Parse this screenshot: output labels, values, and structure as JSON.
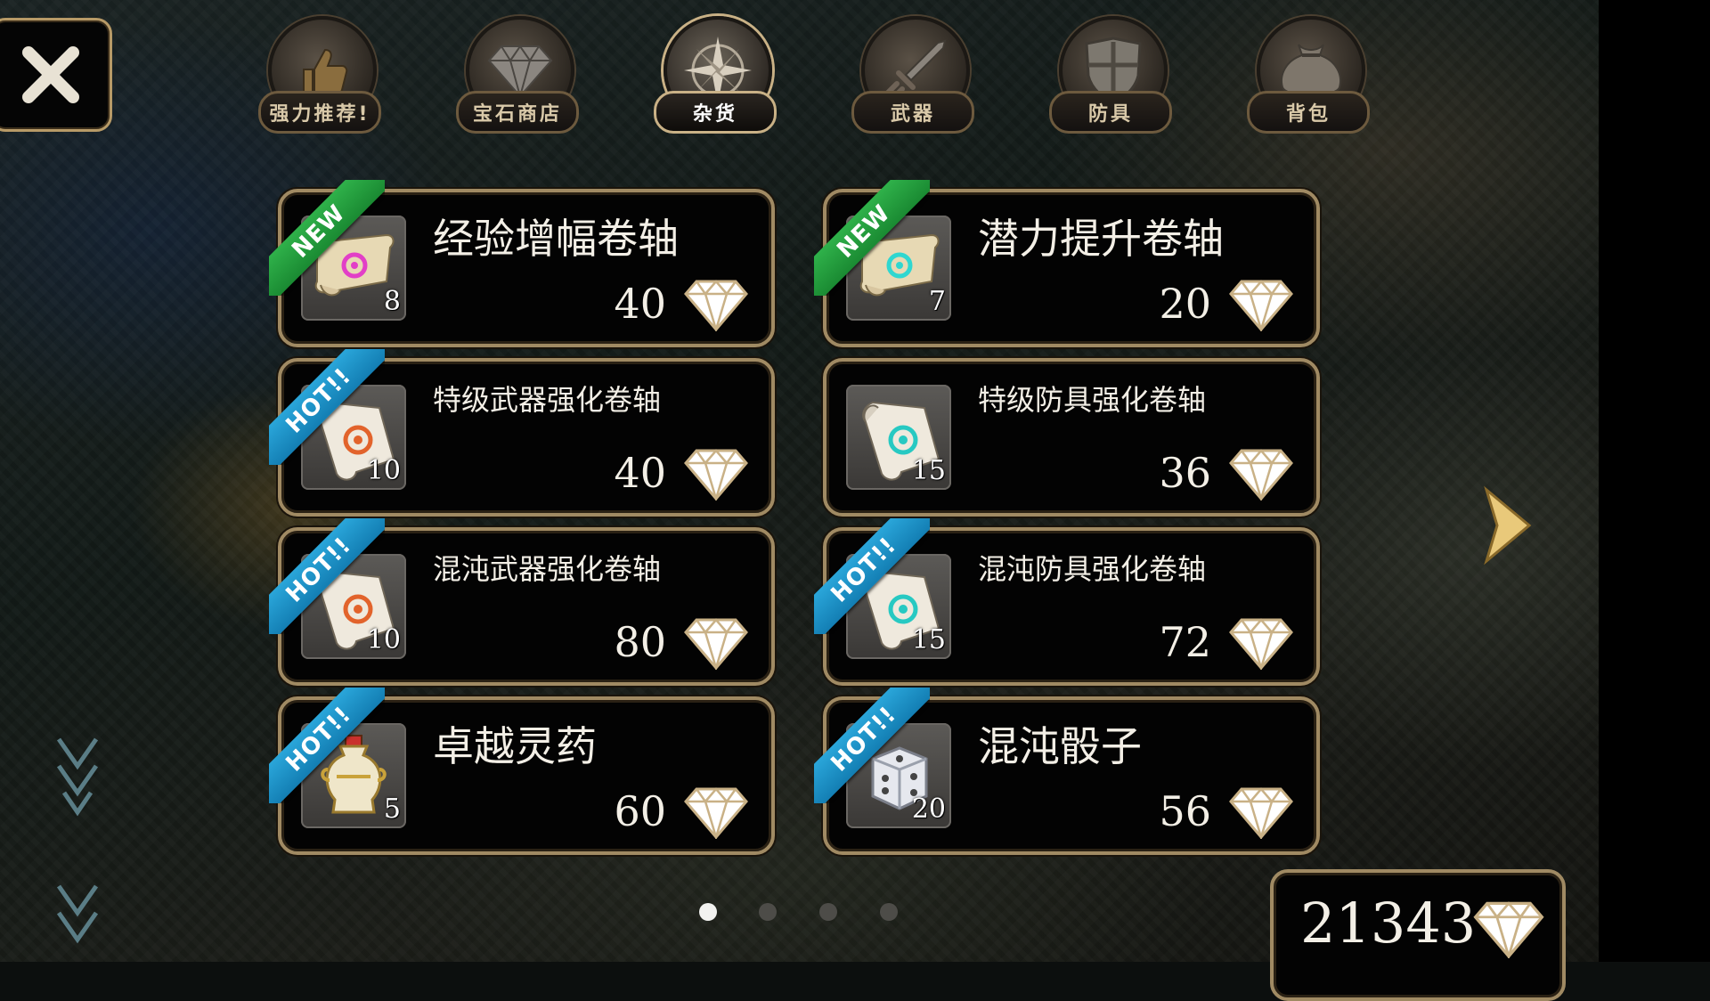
{
  "tabs": [
    {
      "label": "强力推荐!",
      "icon": "thumbs-up-icon",
      "active": false
    },
    {
      "label": "宝石商店",
      "icon": "diamond-icon",
      "active": false
    },
    {
      "label": "杂货",
      "icon": "compass-star-icon",
      "active": true
    },
    {
      "label": "武器",
      "icon": "sword-icon",
      "active": false
    },
    {
      "label": "防具",
      "icon": "shield-icon",
      "active": false
    },
    {
      "label": "背包",
      "icon": "bag-icon",
      "active": false
    }
  ],
  "items": [
    {
      "name": "经验增幅卷轴",
      "price": "40",
      "qty": "8",
      "badge": "NEW",
      "icon": "scroll-pink-icon"
    },
    {
      "name": "潜力提升卷轴",
      "price": "20",
      "qty": "7",
      "badge": "NEW",
      "icon": "scroll-cyan-icon"
    },
    {
      "name": "特级武器强化卷轴",
      "price": "40",
      "qty": "10",
      "badge": "HOT!!",
      "icon": "scroll-orange-icon"
    },
    {
      "name": "特级防具强化卷轴",
      "price": "36",
      "qty": "15",
      "badge": "",
      "icon": "scroll-teal-icon"
    },
    {
      "name": "混沌武器强化卷轴",
      "price": "80",
      "qty": "10",
      "badge": "HOT!!",
      "icon": "scroll-orange-icon"
    },
    {
      "name": "混沌防具强化卷轴",
      "price": "72",
      "qty": "15",
      "badge": "HOT!!",
      "icon": "scroll-teal-icon"
    },
    {
      "name": "卓越灵药",
      "price": "60",
      "qty": "5",
      "badge": "HOT!!",
      "icon": "potion-vase-icon"
    },
    {
      "name": "混沌骰子",
      "price": "56",
      "qty": "20",
      "badge": "HOT!!",
      "icon": "dice-icon"
    }
  ],
  "currency": {
    "gems": "21343",
    "icon": "diamond-icon"
  },
  "pagination": {
    "pages": 4,
    "current": 1
  },
  "colors": {
    "frame": "#a08a63",
    "new_ribbon": "#2fb14a",
    "hot_ribbon": "#2aa6da",
    "panel": "#030303"
  }
}
